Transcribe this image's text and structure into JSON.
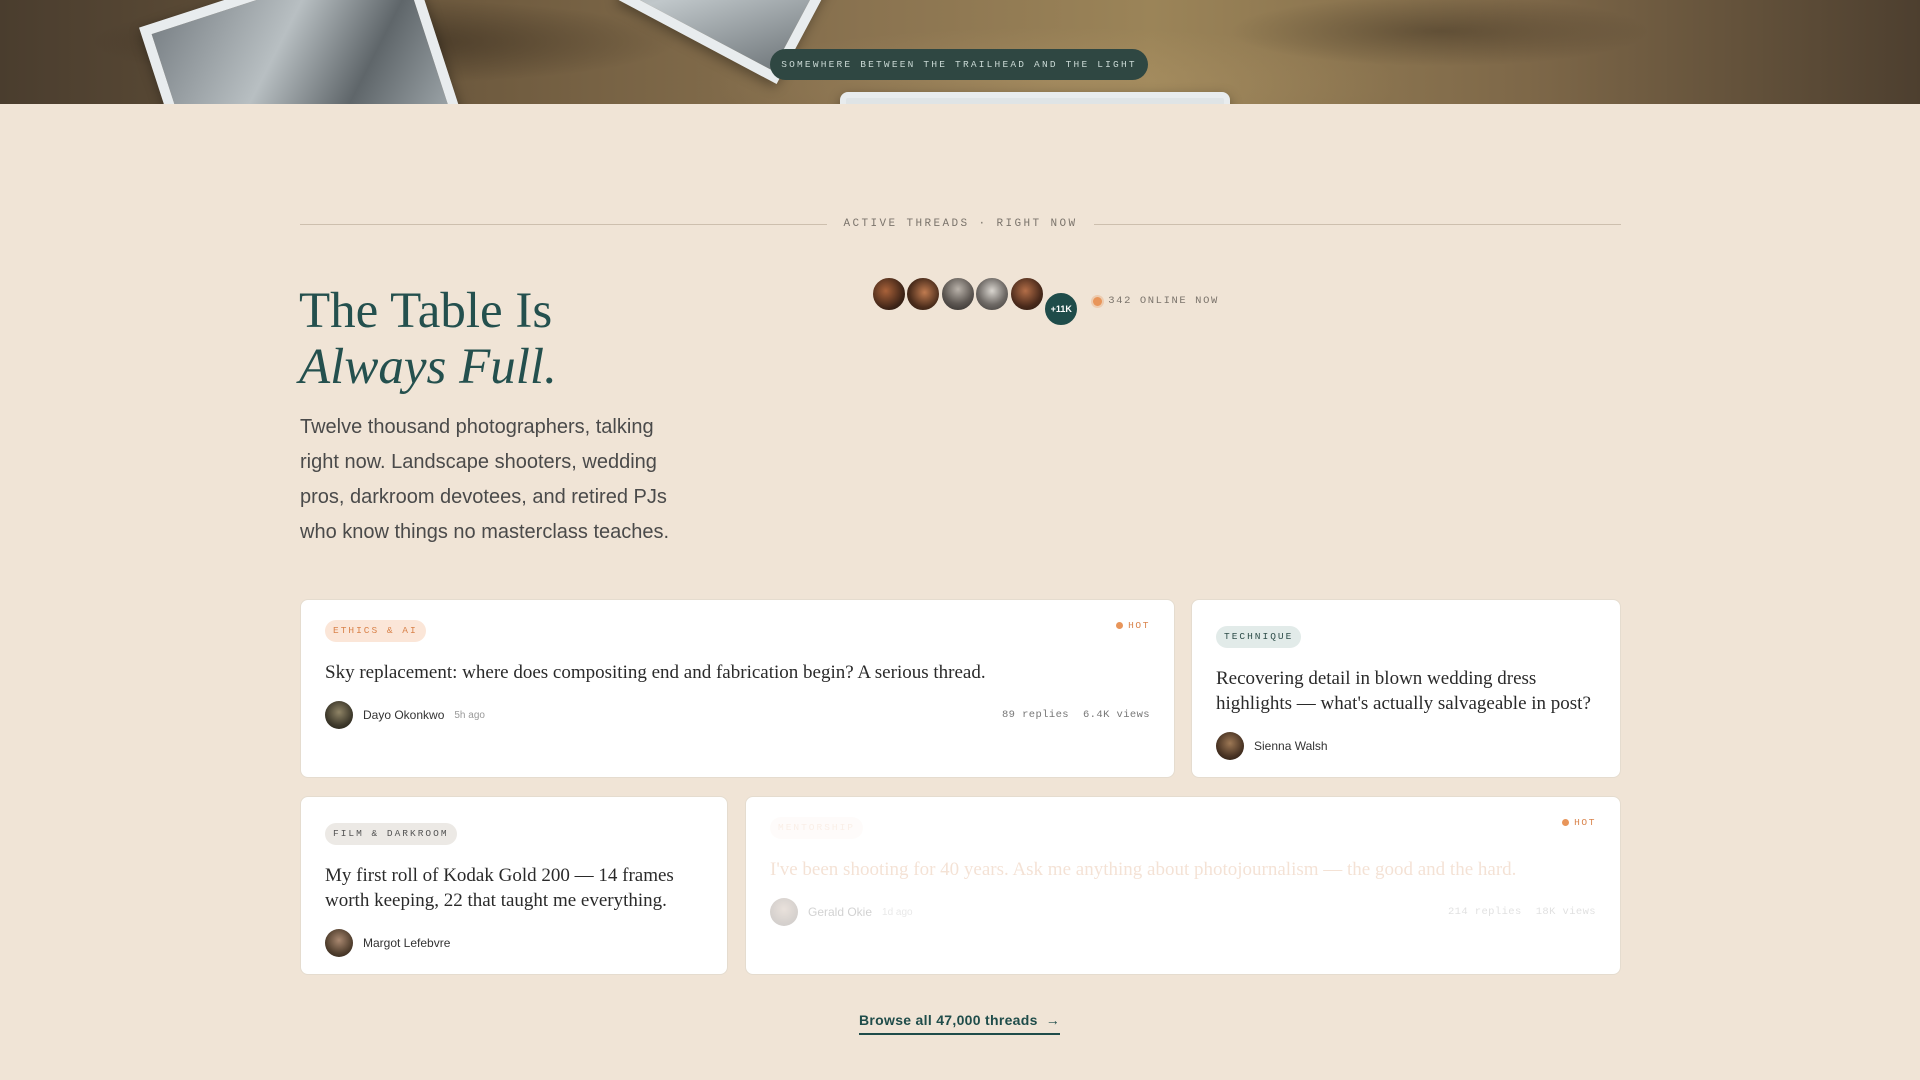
{
  "hero": {
    "tagline": "Somewhere between the trailhead and the light"
  },
  "section": {
    "label": "Active threads · right now"
  },
  "headline": {
    "line1": "The Table Is",
    "line2": "Always Full."
  },
  "lede": "Twelve thousand photographers, talking right now. Landscape shooters, wedding pros, darkroom devotees, and retired PJs who know things no masterclass teaches.",
  "online": {
    "more_badge": "+11K",
    "status": "342 online now"
  },
  "threads": [
    {
      "tag": "Ethics & AI",
      "hot": "Hot",
      "title": "Sky replacement: where does compositing end and fabrication begin? A serious thread.",
      "author": "Dayo Okonkwo",
      "ago": "5h ago",
      "replies": "89 replies",
      "views": "6.4K views"
    },
    {
      "tag": "Technique",
      "title": "Recovering detail in blown wedding dress highlights — what's actually salvageable in post?",
      "author": "Sienna Walsh"
    },
    {
      "tag": "Film & Darkroom",
      "title": "My first roll of Kodak Gold 200 — 14 frames worth keeping, 22 that taught me everything.",
      "author": "Margot Lefebvre"
    },
    {
      "tag": "Mentorship",
      "hot": "Hot",
      "title": "I've been shooting for 40 years. Ask me anything about photojournalism — the good and the hard.",
      "author": "Gerald Okie",
      "ago": "1d ago",
      "replies": "214 replies",
      "views": "18K views"
    }
  ],
  "browse": {
    "label": "Browse all 47,000 threads",
    "icon": "arrow-right-icon"
  },
  "colors": {
    "background": "#f0e4d6",
    "accent_teal": "#1f4c4a",
    "accent_orange": "#e8955a"
  }
}
